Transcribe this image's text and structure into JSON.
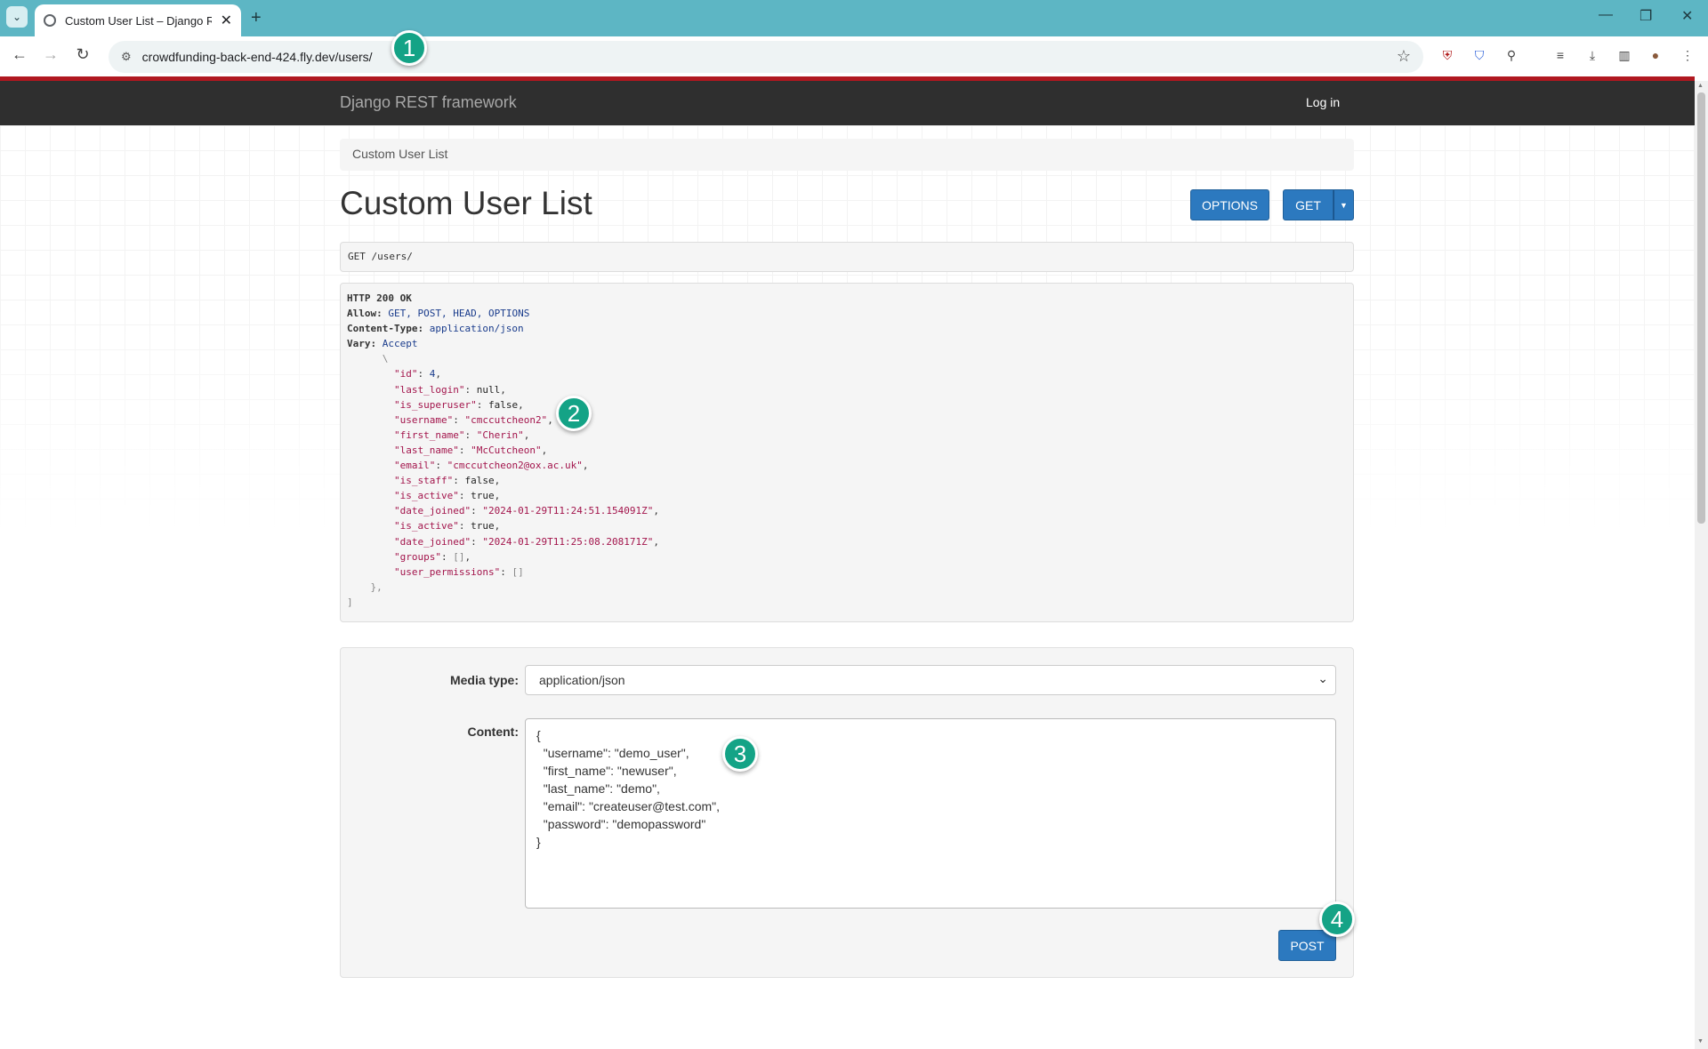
{
  "browser": {
    "tab_title": "Custom User List – Django REST",
    "url": "crowdfunding-back-end-424.fly.dev/users/"
  },
  "navbar": {
    "brand": "Django REST framework",
    "login": "Log in"
  },
  "breadcrumb": "Custom User List",
  "page_title": "Custom User List",
  "buttons": {
    "options": "OPTIONS",
    "get": "GET",
    "post": "POST"
  },
  "request_line": "GET /users/",
  "response": {
    "status": "HTTP 200 OK",
    "headers": [
      {
        "key": "Allow:",
        "value": "GET, POST, HEAD, OPTIONS"
      },
      {
        "key": "Content-Type:",
        "value": "application/json"
      },
      {
        "key": "Vary:",
        "value": "Accept"
      }
    ],
    "body_fields": [
      {
        "key": "\"id\"",
        "value": "4",
        "type": "number"
      },
      {
        "key": "\"last_login\"",
        "value": "null",
        "type": "literal"
      },
      {
        "key": "\"is_superuser\"",
        "value": "false",
        "type": "literal"
      },
      {
        "key": "\"username\"",
        "value": "\"cmccutcheon2\"",
        "type": "string"
      },
      {
        "key": "\"first_name\"",
        "value": "\"Cherin\"",
        "type": "string"
      },
      {
        "key": "\"last_name\"",
        "value": "\"McCutcheon\"",
        "type": "string"
      },
      {
        "key": "\"email\"",
        "value": "\"cmccutcheon2@ox.ac.uk\"",
        "type": "string"
      },
      {
        "key": "\"is_staff\"",
        "value": "false",
        "type": "literal"
      },
      {
        "key": "\"is_active\"",
        "value": "true",
        "type": "literal"
      },
      {
        "key": "\"date_joined\"",
        "value": "\"2024-01-29T11:24:51.154091Z\"",
        "type": "string"
      },
      {
        "key": "\"is_active\"",
        "value": "true",
        "type": "literal"
      },
      {
        "key": "\"date_joined\"",
        "value": "\"2024-01-29T11:25:08.208171Z\"",
        "type": "string"
      },
      {
        "key": "\"groups\"",
        "value": "[]",
        "type": "punct"
      },
      {
        "key": "\"user_permissions\"",
        "value": "[]",
        "type": "punct"
      }
    ]
  },
  "form": {
    "media_type_label": "Media type:",
    "media_type_value": "application/json",
    "content_label": "Content:",
    "content_value": "{\n  \"username\": \"demo_user\",\n  \"first_name\": \"newuser\",\n  \"last_name\": \"demo\",\n  \"email\": \"createuser@test.com\",\n  \"password\": \"demopassword\"\n}"
  },
  "markers": [
    "1",
    "2",
    "3",
    "4"
  ],
  "colors": {
    "accent_button": "#2c79bf",
    "marker": "#14a386",
    "navbar": "#2f2f2f",
    "tabbar": "#5db6c4"
  }
}
